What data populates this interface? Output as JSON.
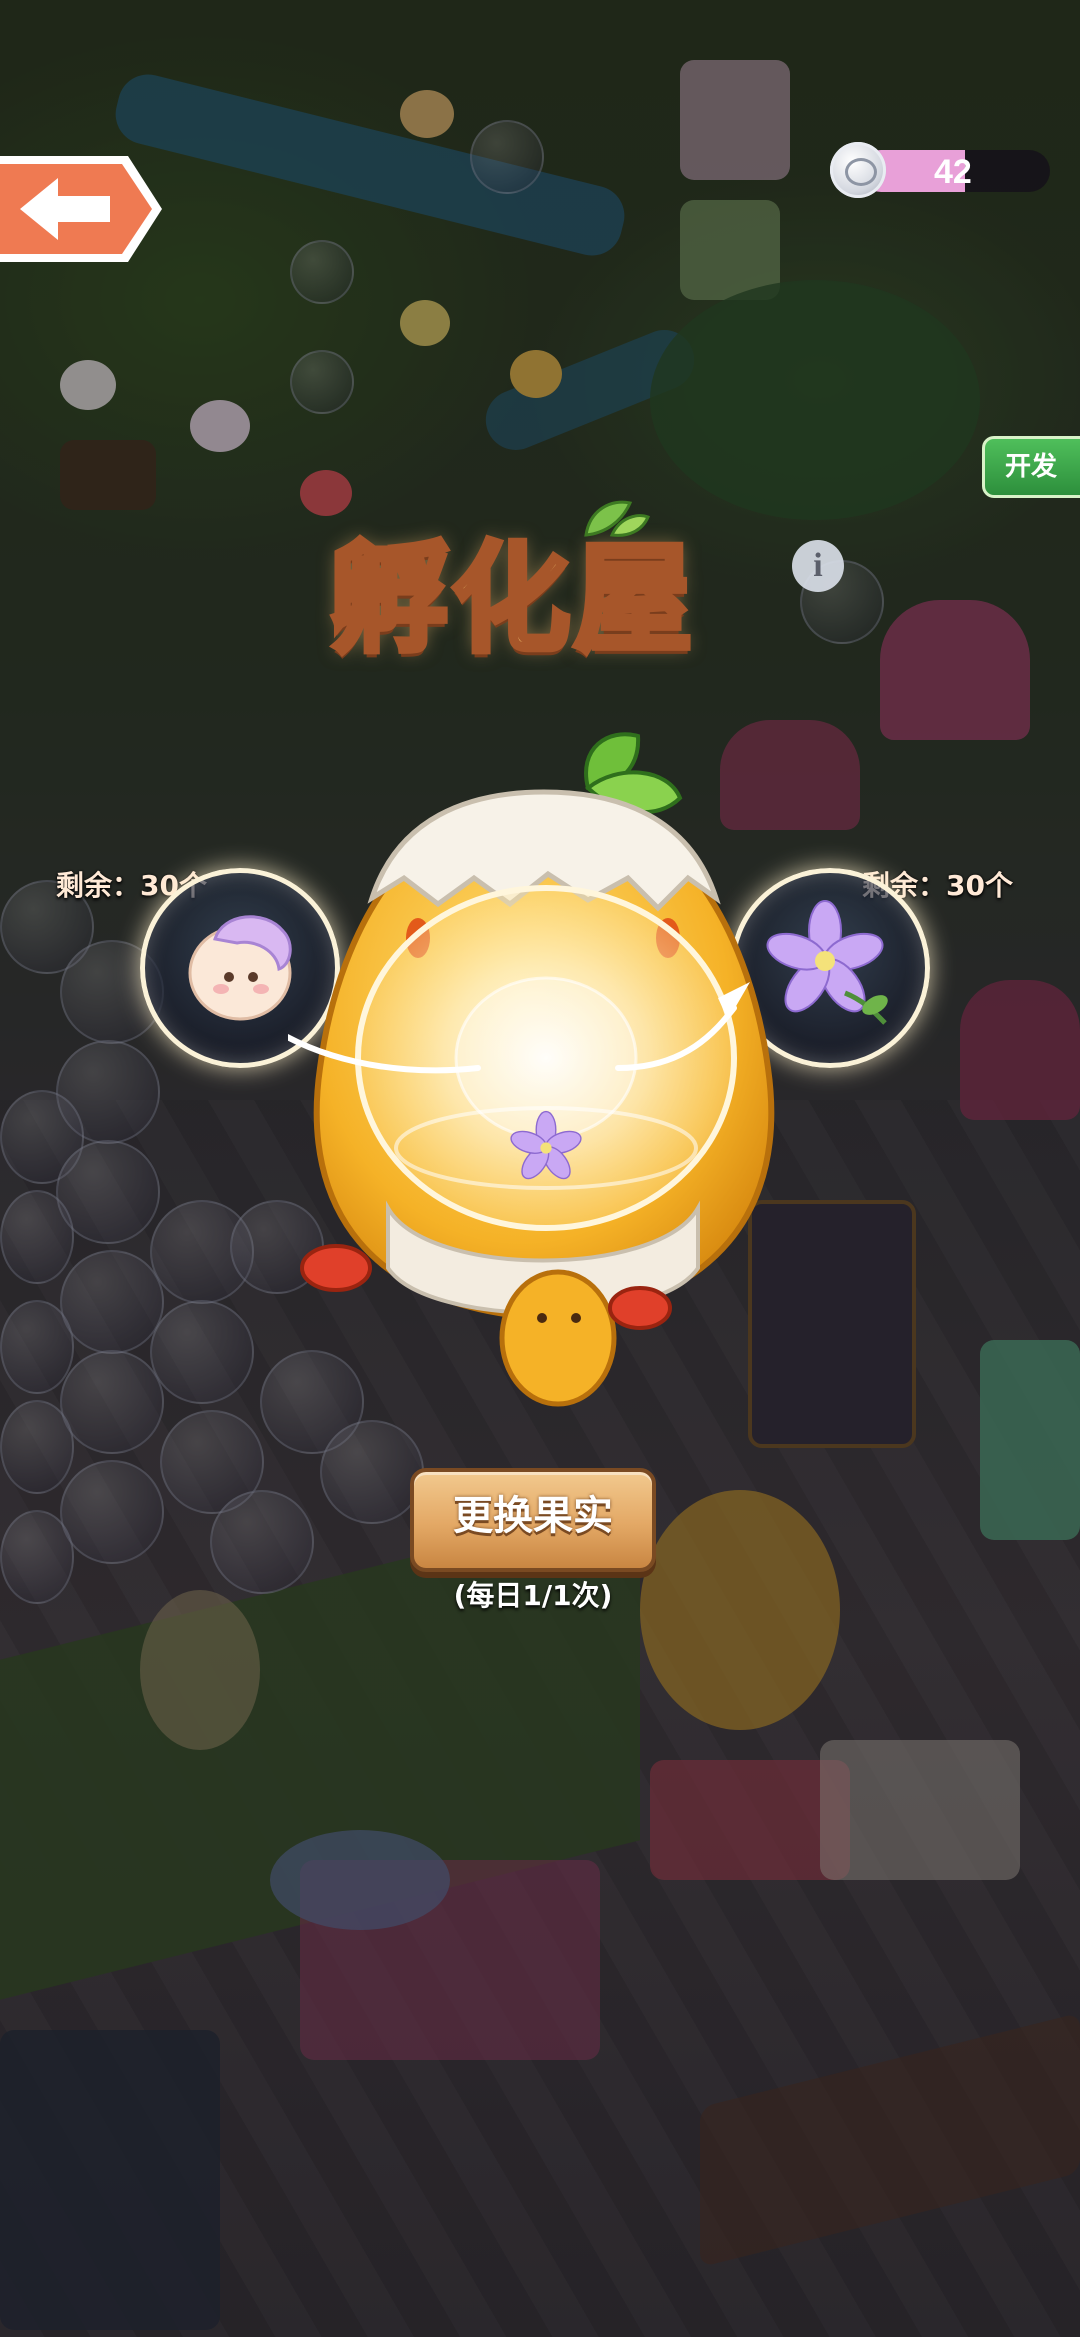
{
  "header": {
    "back_icon": "back-arrow-icon",
    "currency": {
      "icon": "silver-coin-icon",
      "value": "42",
      "bar_fill": 0.55,
      "bar_color": "#e8a0d8"
    },
    "side_button_label": "开发"
  },
  "panel": {
    "title": "孵化屋",
    "info_icon": "info-icon",
    "info_glyph": "i",
    "left_slot": {
      "remaining": "剩余：30个",
      "item_icon": "puff-creature-icon"
    },
    "right_slot": {
      "remaining": "剩余：30个",
      "item_icon": "purple-flower-icon"
    },
    "center_item_icon": "purple-flower-icon",
    "change_button": "更换果实",
    "daily_limit": "(每日1/1次)"
  },
  "colors": {
    "accent": "#ffd27a",
    "button": "#e3a865",
    "title_outline": "#a7562a"
  }
}
